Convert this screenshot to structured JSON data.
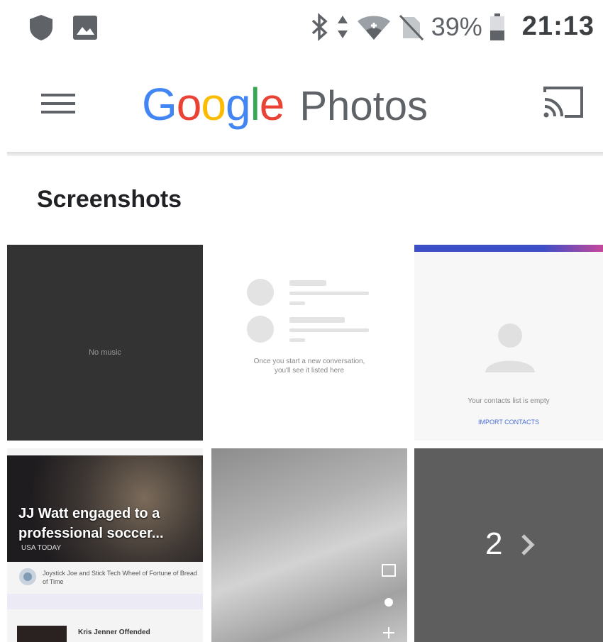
{
  "status_bar": {
    "battery": "39%",
    "time": "21:13",
    "icons_left": [
      "shield-icon",
      "image-icon"
    ],
    "icons_right": [
      "bluetooth-icon",
      "data-arrows-icon",
      "wifi-icon",
      "no-sim-icon",
      "battery-icon"
    ]
  },
  "app_bar": {
    "logo_google": "Google",
    "logo_photos": "Photos",
    "menu_icon": "menu-icon",
    "cast_icon": "cast-icon"
  },
  "section": {
    "title": "Screenshots"
  },
  "thumbnails": {
    "t1_text": "No music",
    "t2_text": "Once you start a new conversation, you'll see it listed here",
    "t3_text": "Your contacts list is empty",
    "t3_link": "IMPORT CONTACTS",
    "t4_headline": "JJ Watt engaged to a professional soccer...",
    "t4_source": "USA TODAY",
    "t4_sub": "Joystick Joe and Stick Tech Wheel of Fortune of Bread of Time",
    "t4_footer": "Kris Jenner Offended"
  },
  "more_tile": {
    "count": "2"
  },
  "colors": {
    "google_blue": "#4285F4",
    "google_red": "#EA4335",
    "google_yellow": "#FBBC05",
    "google_green": "#34A853"
  }
}
